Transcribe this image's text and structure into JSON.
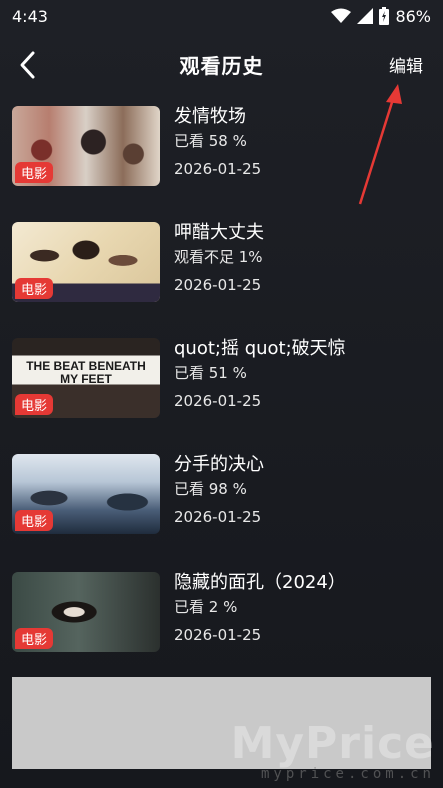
{
  "status_bar": {
    "time": "4:43",
    "battery": "86%"
  },
  "header": {
    "title": "观看历史",
    "edit_label": "编辑"
  },
  "history": [
    {
      "title": "发情牧场",
      "badge": "电影",
      "progress": "已看 58 %",
      "date": "2026-01-25"
    },
    {
      "title": "呷醋大丈夫",
      "badge": "电影",
      "progress": "观看不足 1%",
      "date": "2026-01-25"
    },
    {
      "title": "quot;摇 quot;破天惊",
      "badge": "电影",
      "progress": "已看 51 %",
      "date": "2026-01-25",
      "poster_text": "THE BEAT BENEATH MY FEET"
    },
    {
      "title": "分手的决心",
      "badge": "电影",
      "progress": "已看 98 %",
      "date": "2026-01-25"
    },
    {
      "title": "隐藏的面孔（2024）",
      "badge": "电影",
      "progress": "已看 2 %",
      "date": "2026-01-25"
    }
  ],
  "watermark": {
    "brand": "MyPrice",
    "url": "myprice.com.cn"
  },
  "colors": {
    "background": "#1e2026",
    "badge": "#e53935",
    "arrow": "#e53935"
  }
}
